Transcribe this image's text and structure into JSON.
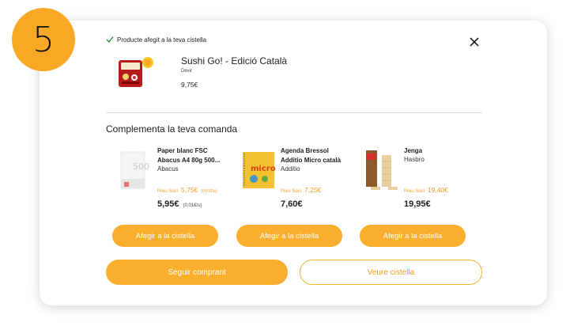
{
  "step_number": "5",
  "confirmation": {
    "message": "Producte afegit a la teva cistella"
  },
  "added_product": {
    "title": "Sushi Go! - Edició Català",
    "brand": "Devir",
    "price": "9,75€"
  },
  "section_title": "Complementa la teva comanda",
  "products": [
    {
      "name_line1": "Paper blanc FSC",
      "name_line2": "Abacus A4 80g 500...",
      "brand": "Abacus",
      "soci_label": "Preu Soci",
      "soci_price": "5,75€",
      "soci_unit": "(0,01€/u)",
      "price": "5,95€",
      "price_unit": "(0,01€/u)",
      "add_label": "Afegir a la cistella"
    },
    {
      "name_line1": "Agenda Bressol",
      "name_line2": "Additio Micro català",
      "brand": "Additio",
      "soci_label": "Preu Soci",
      "soci_price": "7,25€",
      "price": "7,60€",
      "add_label": "Afegir a la cistella"
    },
    {
      "name_line1": "Jenga",
      "brand": "Hasbro",
      "soci_label": "Preu Soci",
      "soci_price": "19,40€",
      "price": "19,95€",
      "add_label": "Afegir a la cistella"
    }
  ],
  "actions": {
    "keep_shopping": "Seguir comprant",
    "view_cart": "Veure cistella"
  },
  "colors": {
    "accent": "#f9ae2e",
    "accent_text": "#f29b1d",
    "badge": "#f9a825",
    "check": "#2e8b3a"
  },
  "icons": [
    "check-icon",
    "close-icon"
  ]
}
